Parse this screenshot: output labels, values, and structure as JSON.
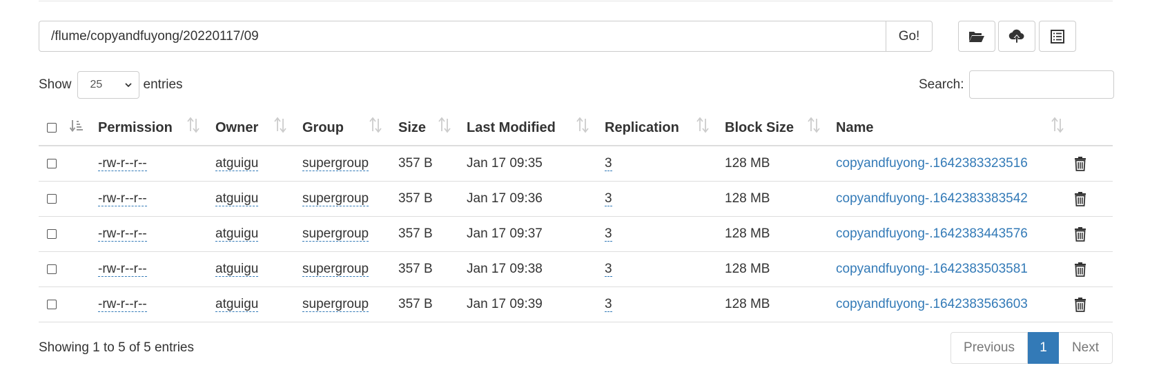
{
  "path_bar": {
    "path_value": "/flume/copyandfuyong/20220117/09",
    "go_label": "Go!"
  },
  "toolbar": {
    "icons": [
      "folder-open-icon",
      "cloud-upload-icon",
      "list-icon"
    ]
  },
  "length_menu": {
    "show_label": "Show",
    "selected": "25",
    "entries_label": "entries"
  },
  "search": {
    "label": "Search:",
    "value": ""
  },
  "table": {
    "headers": {
      "permission": "Permission",
      "owner": "Owner",
      "group": "Group",
      "size": "Size",
      "last_modified": "Last Modified",
      "replication": "Replication",
      "block_size": "Block Size",
      "name": "Name"
    },
    "rows": [
      {
        "permission": "-rw-r--r--",
        "owner": "atguigu",
        "group": "supergroup",
        "size": "357 B",
        "last_modified": "Jan 17 09:35",
        "replication": "3",
        "block_size": "128 MB",
        "name": "copyandfuyong-.1642383323516"
      },
      {
        "permission": "-rw-r--r--",
        "owner": "atguigu",
        "group": "supergroup",
        "size": "357 B",
        "last_modified": "Jan 17 09:36",
        "replication": "3",
        "block_size": "128 MB",
        "name": "copyandfuyong-.1642383383542"
      },
      {
        "permission": "-rw-r--r--",
        "owner": "atguigu",
        "group": "supergroup",
        "size": "357 B",
        "last_modified": "Jan 17 09:37",
        "replication": "3",
        "block_size": "128 MB",
        "name": "copyandfuyong-.1642383443576"
      },
      {
        "permission": "-rw-r--r--",
        "owner": "atguigu",
        "group": "supergroup",
        "size": "357 B",
        "last_modified": "Jan 17 09:38",
        "replication": "3",
        "block_size": "128 MB",
        "name": "copyandfuyong-.1642383503581"
      },
      {
        "permission": "-rw-r--r--",
        "owner": "atguigu",
        "group": "supergroup",
        "size": "357 B",
        "last_modified": "Jan 17 09:39",
        "replication": "3",
        "block_size": "128 MB",
        "name": "copyandfuyong-.1642383563603"
      }
    ]
  },
  "footer": {
    "info": "Showing 1 to 5 of 5 entries",
    "previous": "Previous",
    "current_page": "1",
    "next": "Next"
  },
  "colors": {
    "link": "#337ab7",
    "border": "#dddddd"
  }
}
